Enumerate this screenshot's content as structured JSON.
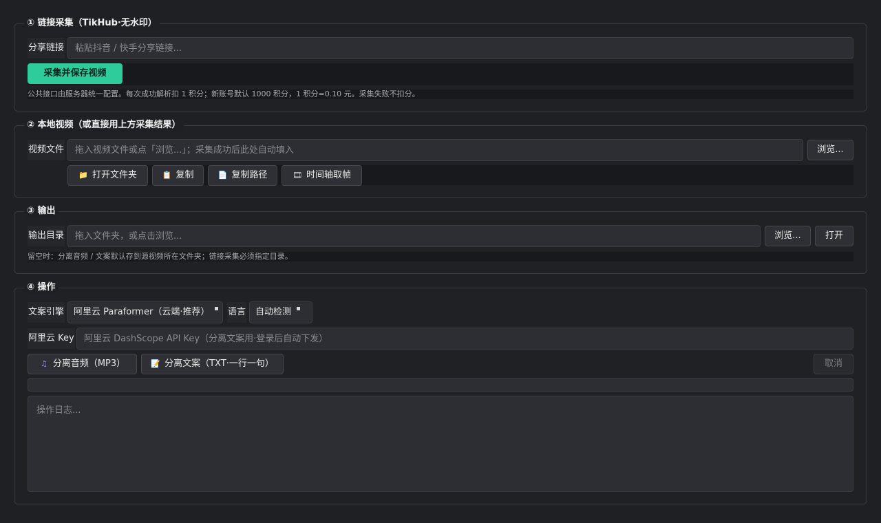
{
  "section1": {
    "title": "① 链接采集（TikHub·无水印）",
    "share_label": "分享链接",
    "share_placeholder": "粘贴抖音 / 快手分享链接...",
    "share_value": "",
    "collect_button": "采集并保存视频",
    "note": "公共接口由服务器统一配置。每次成功解析扣 1 积分；新账号默认 1000 积分，1 积分=0.10 元。采集失败不扣分。"
  },
  "section2": {
    "title": "② 本地视频（或直接用上方采集结果）",
    "file_label": "视频文件",
    "file_placeholder": "拖入视频文件或点「浏览...」；采集成功后此处自动填入",
    "file_value": "",
    "browse_button": "浏览...",
    "open_folder_button": "打开文件夹",
    "copy_button": "复制",
    "copy_path_button": "复制路径",
    "timeline_button": "时间轴取帧",
    "open_folder_icon": "folder-icon",
    "copy_icon": "clipboard-icon",
    "copy_path_icon": "document-icon",
    "timeline_icon": "film-icon"
  },
  "section3": {
    "title": "③ 输出",
    "dir_label": "输出目录",
    "dir_placeholder": "拖入文件夹，或点击浏览...",
    "dir_value": "",
    "browse_button": "浏览...",
    "open_button": "打开",
    "note": "留空时：分离音频 / 文案默认存到源视频所在文件夹；链接采集必须指定目录。"
  },
  "section4": {
    "title": "④ 操作",
    "engine_label": "文案引擎",
    "engine_value": "阿里云 Paraformer（云端·推荐）",
    "lang_label": "语言",
    "lang_value": "自动检测",
    "key_label": "阿里云 Key",
    "key_placeholder": "阿里云 DashScope API Key（分离文案用·登录后自动下发）",
    "key_value": "",
    "audio_button": "分离音频（MP3）",
    "audio_icon": "music-note-icon",
    "text_button": "分离文案（TXT·一行一句）",
    "text_icon": "memo-icon",
    "cancel_button": "取消",
    "progress_fraction": 0,
    "log_placeholder": "操作日志...",
    "log_value": ""
  },
  "colors": {
    "background": "#1f2023",
    "accent": "#2ecc9b",
    "panel_border": "#3a3b40",
    "input_bg": "#2d2e33"
  }
}
